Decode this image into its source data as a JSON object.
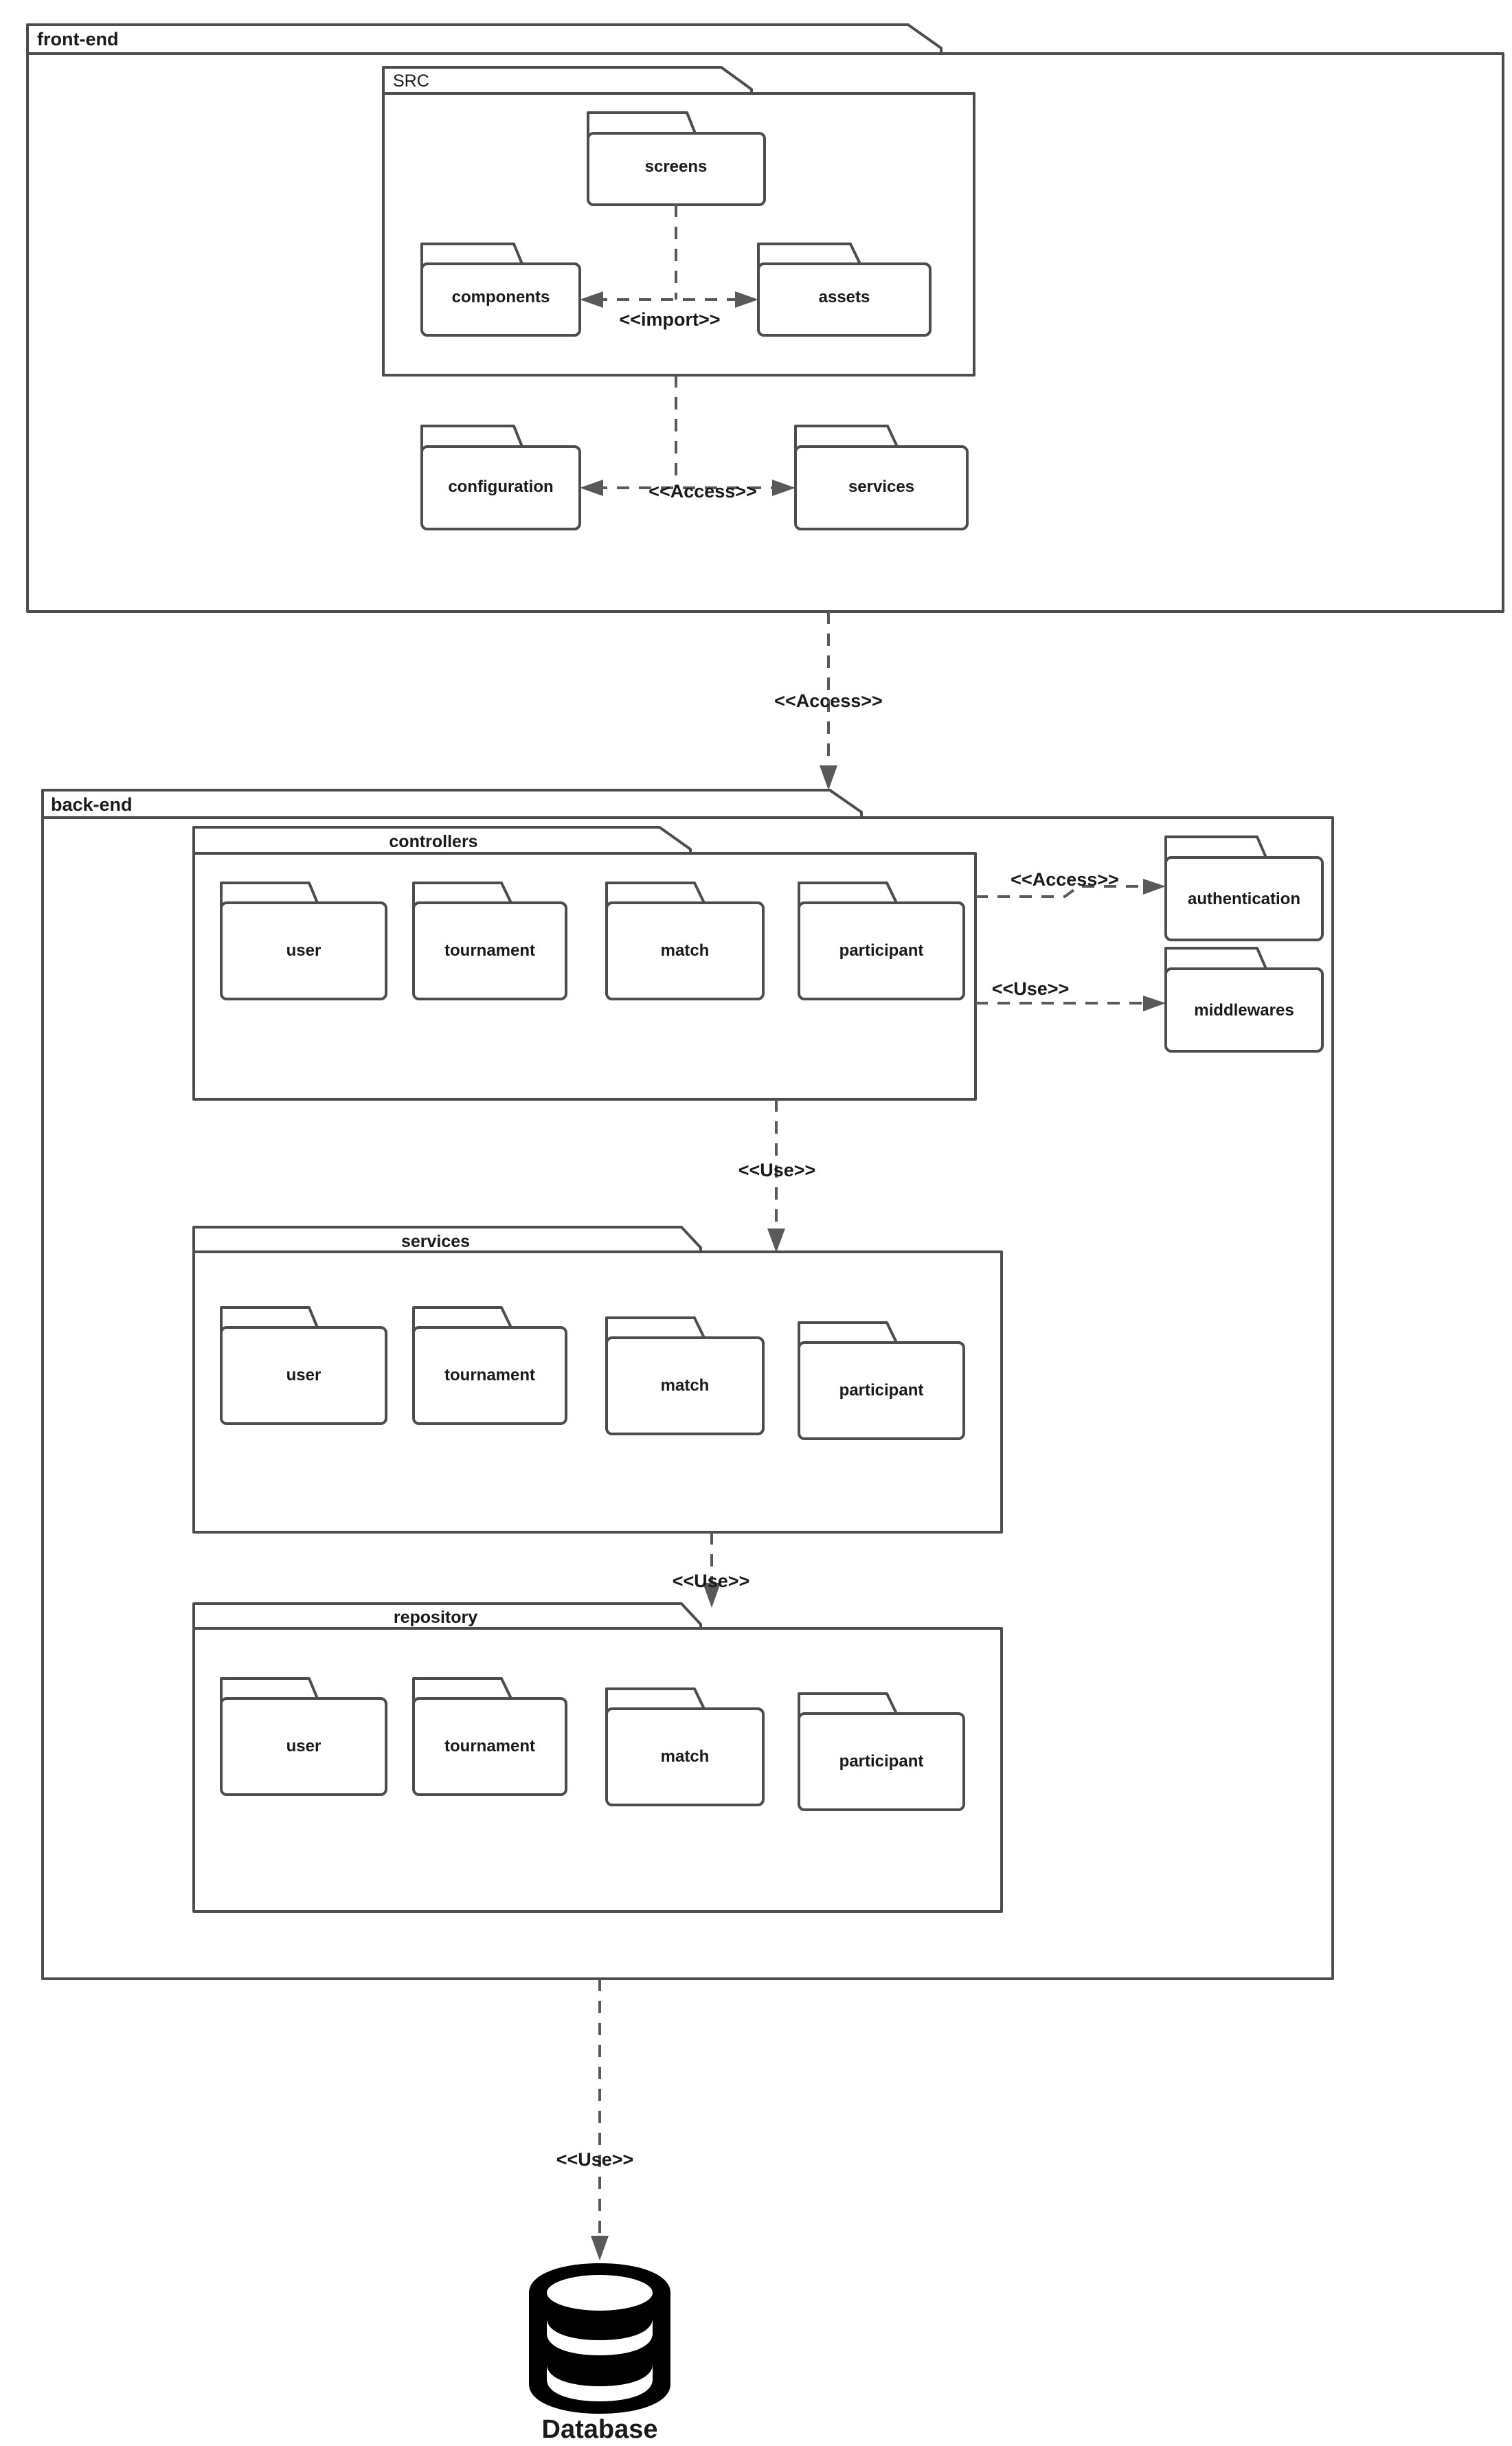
{
  "diagram": {
    "title_hidden": "",
    "packages": {
      "frontend": {
        "label": "front-end",
        "src": {
          "label": "SRC",
          "folders": [
            {
              "label": "screens"
            },
            {
              "label": "components"
            },
            {
              "label": "assets"
            }
          ],
          "relations": [
            {
              "label": "<<import>>",
              "from": "components",
              "to": "assets"
            }
          ]
        },
        "folders": [
          {
            "label": "configuration"
          },
          {
            "label": "services"
          }
        ],
        "relations": [
          {
            "label": "<<Access>>",
            "from": "configuration",
            "to": "services"
          }
        ]
      },
      "backend": {
        "label": "back-end",
        "controllers": {
          "label": "controllers",
          "folders": [
            {
              "label": "user"
            },
            {
              "label": "tournament"
            },
            {
              "label": "match"
            },
            {
              "label": "participant"
            }
          ]
        },
        "services": {
          "label": "services",
          "folders": [
            {
              "label": "user"
            },
            {
              "label": "tournament"
            },
            {
              "label": "match"
            },
            {
              "label": "participant"
            }
          ]
        },
        "repository": {
          "label": "repository",
          "folders": [
            {
              "label": "user"
            },
            {
              "label": "tournament"
            },
            {
              "label": "match"
            },
            {
              "label": "participant"
            }
          ]
        },
        "side_folders": [
          {
            "label": "authentication"
          },
          {
            "label": "middlewares"
          }
        ]
      }
    },
    "database": {
      "label": "Database",
      "icon": "database-cylinder-icon"
    },
    "relations": [
      {
        "label": "<<Access>>",
        "from": "front-end",
        "to": "back-end"
      },
      {
        "label": "<<Access>>",
        "from": "controllers",
        "to": "authentication"
      },
      {
        "label": "<<Use>>",
        "from": "controllers",
        "to": "middlewares"
      },
      {
        "label": "<<Use>>",
        "from": "controllers",
        "to": "services"
      },
      {
        "label": "<<Use>>",
        "from": "services",
        "to": "repository"
      },
      {
        "label": "<<Use>>",
        "from": "back-end",
        "to": "Database"
      }
    ],
    "colors": {
      "stroke": "#4d4d4d",
      "connector": "#595959",
      "text": "#1a1a1a",
      "background": "#ffffff",
      "database": "#000000"
    }
  }
}
